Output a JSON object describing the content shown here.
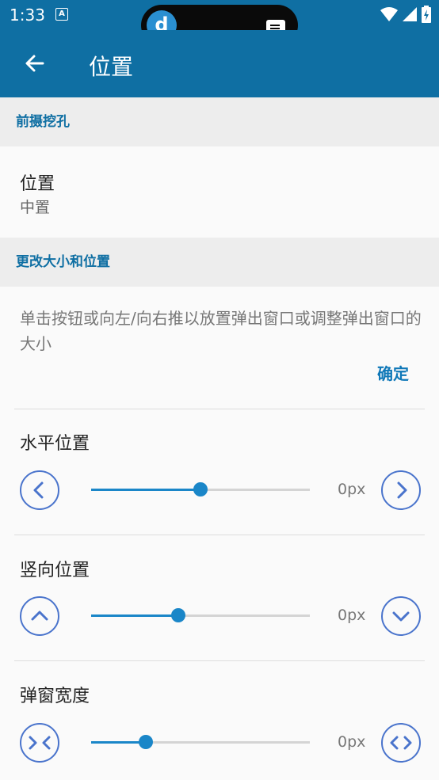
{
  "status": {
    "time": "1:33",
    "notif": "A"
  },
  "pill": {
    "logo": "d"
  },
  "appbar": {
    "title": "位置"
  },
  "sections": {
    "camera_cutout": "前摄挖孔",
    "resize_position": "更改大小和位置"
  },
  "position_pref": {
    "title": "位置",
    "value": "中置"
  },
  "description": "单击按钮或向左/向右推以放置弹出窗口或调整弹出窗口的大小",
  "confirm_label": "确定",
  "rows": [
    {
      "title": "水平位置",
      "value_text": "0px",
      "progress": 0.5
    },
    {
      "title": "竖向位置",
      "value_text": "0px",
      "progress": 0.4
    },
    {
      "title": "弹窗宽度",
      "value_text": "0px",
      "progress": 0.25
    }
  ],
  "colors": {
    "primary": "#0f6fa3",
    "accent": "#1a86c8",
    "button_outline": "#4a74cc"
  },
  "icons": {
    "back": "arrow-left-icon",
    "row0_left": "chevron-left-icon",
    "row0_right": "chevron-right-icon",
    "row1_left": "chevron-up-icon",
    "row1_right": "chevron-down-icon",
    "row2_left": "shrink-horizontal-icon",
    "row2_right": "expand-horizontal-icon"
  }
}
